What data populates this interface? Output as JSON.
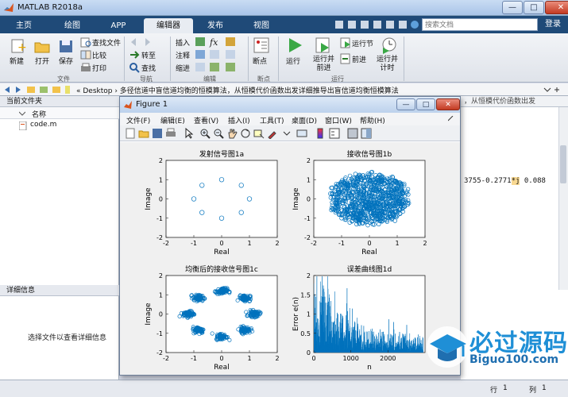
{
  "window": {
    "title": "MATLAB R2018a",
    "minimize": "—",
    "maximize": "□",
    "close": "✕"
  },
  "tabs": [
    "主页",
    "绘图",
    "APP",
    "编辑器",
    "发布",
    "视图"
  ],
  "search": {
    "placeholder": "搜索文档",
    "signin": "登录"
  },
  "ribbon": {
    "new_label": "新建",
    "open_label": "打开",
    "save_label": "保存",
    "find_files": "查找文件",
    "compare": "比较",
    "print": "打印",
    "goto": "转至",
    "find": "查找",
    "insert": "插入",
    "comment": "注释",
    "indent": "缩进",
    "breakpoints": "断点",
    "run": "运行",
    "run_advance": "运行并\n前进",
    "run_section": "运行节",
    "advance": "前进",
    "run_time": "运行并\n计时",
    "groups": {
      "file": "文件",
      "navigate": "导航",
      "edit": "编辑",
      "breakpoints": "断点",
      "run": "运行"
    }
  },
  "address": {
    "path": "« Desktop  ›  多径信道中盲信道均衡的恒模算法，从恒模代价函数出发详细推导出盲信道均衡恒模算法"
  },
  "left_panel": {
    "title": "当前文件夹",
    "column_name": "名称",
    "files": [
      "code.m"
    ],
    "detail_title": "详细信息",
    "detail_message": "选择文件以查看详细信息"
  },
  "command_window": {
    "head": "，从恒模代价函数出发",
    "text_a": "3755-0.2771",
    "text_j": "*j",
    "text_b": " 0.088"
  },
  "status": {
    "row_label": "行",
    "row": "1",
    "col_label": "列",
    "col": "1"
  },
  "figure": {
    "title": "Figure 1",
    "menus": [
      "文件(F)",
      "编辑(E)",
      "查看(V)",
      "插入(I)",
      "工具(T)",
      "桌面(D)",
      "窗口(W)",
      "帮助(H)"
    ]
  },
  "chart_data": [
    {
      "type": "scatter",
      "title": "发射信号图1a",
      "xlabel": "Real",
      "ylabel": "Image",
      "xlim": [
        -2,
        2
      ],
      "ylim": [
        -2,
        2
      ],
      "xticks": [
        -2,
        -1,
        0,
        1,
        2
      ],
      "yticks": [
        -2,
        -1,
        0,
        1,
        2
      ],
      "series": [
        {
          "x": [
            1,
            0.707,
            0,
            -0.707,
            -1,
            -0.707,
            0,
            0.707
          ],
          "y": [
            0,
            0.707,
            1,
            0.707,
            0,
            -0.707,
            -1,
            -0.707
          ]
        }
      ]
    },
    {
      "type": "scatter",
      "title": "接收信号图1b",
      "xlabel": "Real",
      "ylabel": "Image",
      "xlim": [
        -2,
        2
      ],
      "ylim": [
        -2,
        2
      ],
      "xticks": [
        -2,
        -1,
        0,
        1,
        2
      ],
      "yticks": [
        -2,
        -1,
        0,
        1,
        2
      ],
      "cloud": {
        "center": [
          0,
          0
        ],
        "radius_x": 1.4,
        "radius_y": 1.3
      }
    },
    {
      "type": "scatter",
      "title": "均衡后的接收信号图1c",
      "xlabel": "Real",
      "ylabel": "Image",
      "xlim": [
        -2,
        2
      ],
      "ylim": [
        -2,
        2
      ],
      "xticks": [
        -2,
        -1,
        0,
        1,
        2
      ],
      "yticks": [
        -2,
        -1,
        0,
        1,
        2
      ],
      "clusters": [
        [
          1.18,
          0
        ],
        [
          0.83,
          0.83
        ],
        [
          0,
          1.18
        ],
        [
          -0.83,
          0.83
        ],
        [
          -1.18,
          0
        ],
        [
          -0.83,
          -0.83
        ],
        [
          0,
          -1.18
        ],
        [
          0.83,
          -0.83
        ]
      ]
    },
    {
      "type": "line",
      "title": "误差曲线图1d",
      "xlabel": "n",
      "ylabel": "Error e(n)",
      "xlim": [
        0,
        3000
      ],
      "ylim": [
        0,
        2
      ],
      "xticks": [
        0,
        1000,
        2000
      ],
      "yticks": [
        0,
        0.5,
        1,
        1.5,
        2
      ]
    }
  ],
  "watermark": {
    "main": "必过源码",
    "sub": "Biguo100.com"
  },
  "colors": {
    "marker": "#0072bd",
    "tab_bar": "#1f4a78"
  }
}
